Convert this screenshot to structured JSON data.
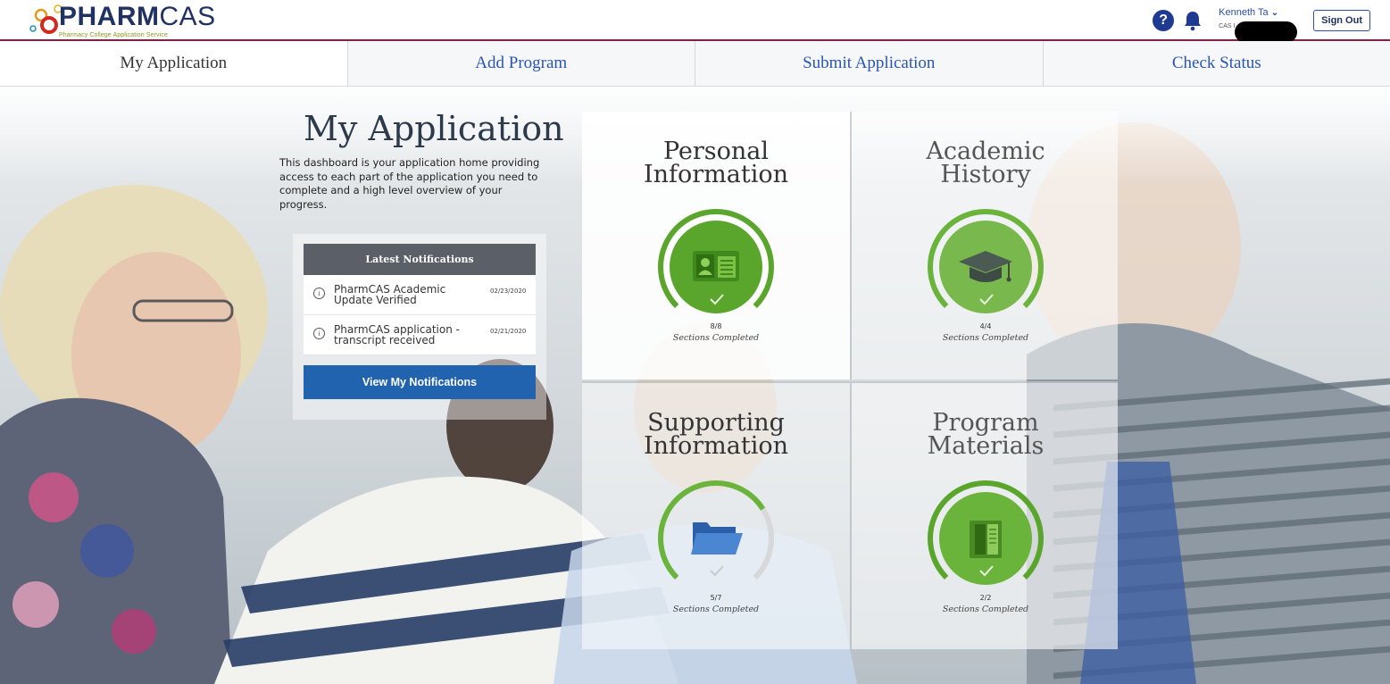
{
  "header": {
    "logo_word_bold": "PHARM",
    "logo_word_light": "CAS",
    "logo_subtitle": "Pharmacy College Application Service",
    "help_label": "?",
    "user_name": "Kenneth Ta",
    "user_sub": "CAS I",
    "signout_label": "Sign Out"
  },
  "tabs": [
    {
      "label": "My Application",
      "active": true
    },
    {
      "label": "Add Program",
      "active": false
    },
    {
      "label": "Submit Application",
      "active": false
    },
    {
      "label": "Check Status",
      "active": false
    }
  ],
  "intro": {
    "title": "My Application",
    "text": "This dashboard is your application home providing access to each part of the application you need to complete and a high level overview of your progress."
  },
  "notifications": {
    "title": "Latest Notifications",
    "items": [
      {
        "text": "PharmCAS Academic Update Verified",
        "date": "02/23/2020"
      },
      {
        "text": "PharmCAS application - transcript received",
        "date": "02/21/2020"
      }
    ],
    "button_label": "View My Notifications"
  },
  "sections": [
    {
      "title_line1": "Personal",
      "title_line2": "Information",
      "count": "8/8",
      "label": "Sections Completed",
      "completed": 8,
      "total": 8,
      "icon": "id-card-icon"
    },
    {
      "title_line1": "Academic",
      "title_line2": "History",
      "count": "4/4",
      "label": "Sections Completed",
      "completed": 4,
      "total": 4,
      "icon": "graduation-cap-icon"
    },
    {
      "title_line1": "Supporting",
      "title_line2": "Information",
      "count": "5/7",
      "label": "Sections Completed",
      "completed": 5,
      "total": 7,
      "icon": "folder-icon"
    },
    {
      "title_line1": "Program",
      "title_line2": "Materials",
      "count": "2/2",
      "label": "Sections Completed",
      "completed": 2,
      "total": 2,
      "icon": "book-icon"
    }
  ],
  "colors": {
    "brand_navy": "#1f3263",
    "accent_maroon": "#7c2244",
    "link_blue": "#2a55b5",
    "button_blue": "#2263b0",
    "progress_green": "#5aa52b",
    "complete_green": "#6ab43c"
  }
}
